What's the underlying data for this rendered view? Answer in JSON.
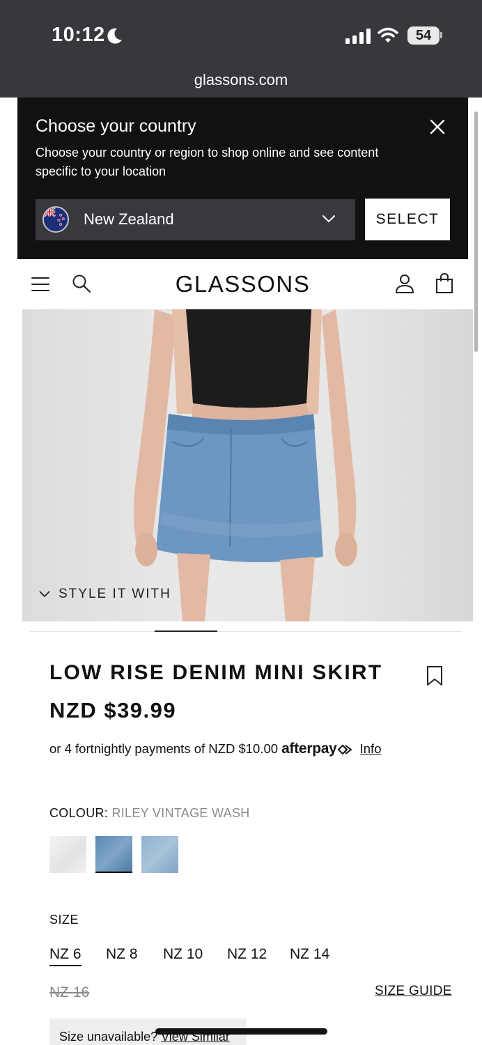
{
  "status_bar": {
    "time": "10:12",
    "battery": "54",
    "url": "glassons.com"
  },
  "country_modal": {
    "title": "Choose your country",
    "description": "Choose your country or region to shop online and see content specific to your location",
    "selected_country": "New Zealand",
    "select_label": "SELECT",
    "icons": [
      "close-icon",
      "nz-flag-icon",
      "chevron-down-icon"
    ]
  },
  "header": {
    "logo": "GLASSONS",
    "icons": [
      "menu-icon",
      "search-icon",
      "account-icon",
      "bag-icon"
    ]
  },
  "product": {
    "style_it_with": "STYLE IT WITH",
    "title": "LOW RISE DENIM MINI SKIRT",
    "price": "NZD $39.99",
    "afterpay_text": "or 4 fortnightly payments of NZD $10.00",
    "afterpay_brand": "afterpay",
    "afterpay_info": "Info",
    "colour_label": "COLOUR:",
    "colour_value": "RILEY VINTAGE WASH",
    "swatches": [
      "white",
      "riley vintage wash",
      "light wash"
    ],
    "size_label": "SIZE",
    "sizes": [
      "NZ 6",
      "NZ 8",
      "NZ 10",
      "NZ 12",
      "NZ 14"
    ],
    "selected_size": "NZ 6",
    "unavailable_size": "NZ 16",
    "size_guide": "SIZE GUIDE",
    "size_unavailable_text": "Size unavailable?",
    "view_similar": "View Similar"
  },
  "colors": {
    "status_bar_bg": "#36383c",
    "modal_bg": "#111111",
    "dropdown_bg": "#37393d"
  }
}
